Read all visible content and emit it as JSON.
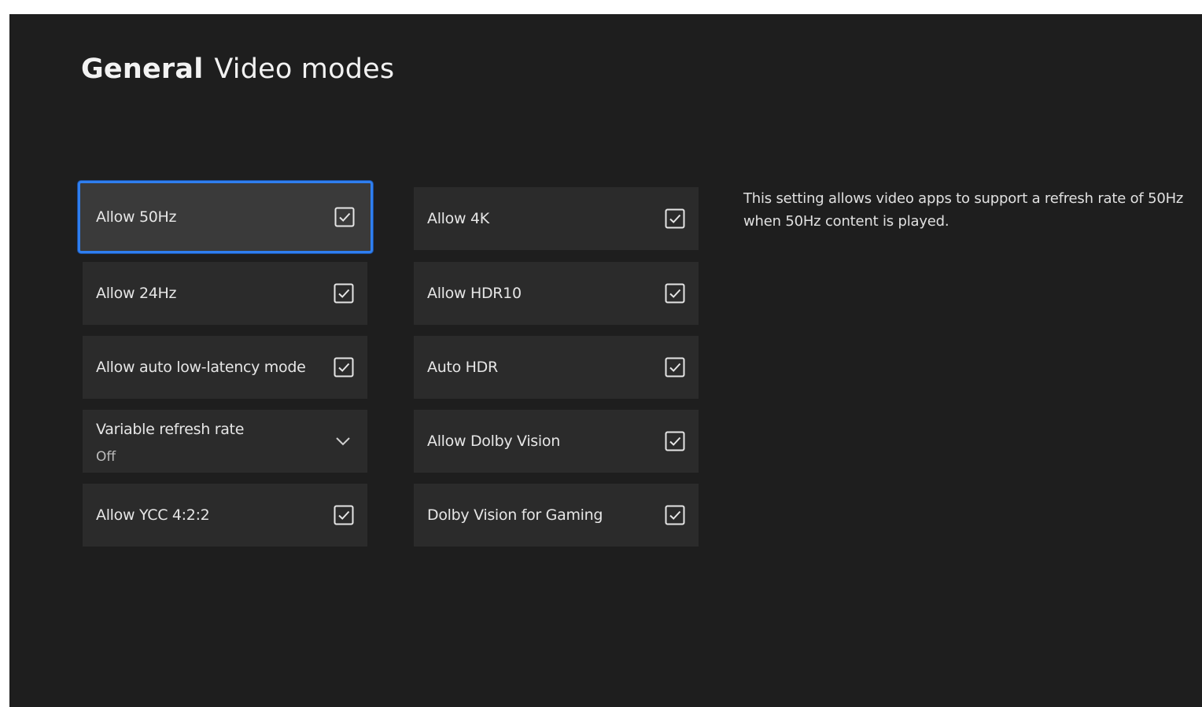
{
  "header": {
    "breadcrumb": "General",
    "title": "Video modes"
  },
  "left_column": [
    {
      "label": "Allow 50Hz",
      "checked": true,
      "focused": true
    },
    {
      "label": "Allow 24Hz",
      "checked": true
    },
    {
      "label": "Allow auto low-latency mode",
      "checked": true
    },
    {
      "label": "Variable refresh rate",
      "value": "Off",
      "type": "dropdown"
    },
    {
      "label": "Allow YCC 4:2:2",
      "checked": true
    }
  ],
  "right_column": [
    {
      "label": "Allow 4K",
      "checked": true
    },
    {
      "label": "Allow HDR10",
      "checked": true
    },
    {
      "label": "Auto HDR",
      "checked": true
    },
    {
      "label": "Allow Dolby Vision",
      "checked": true
    },
    {
      "label": "Dolby Vision for Gaming",
      "checked": true
    }
  ],
  "description": "This setting allows video apps to support a refresh rate of 50Hz when 50Hz content is played.",
  "colors": {
    "background": "#1e1e1e",
    "tile": "#2b2b2b",
    "focus_border": "#2f7ff0",
    "text": "#e6e6e6"
  },
  "icons": {
    "checkbox": "checkbox-checked-icon",
    "dropdown": "chevron-down-icon"
  }
}
